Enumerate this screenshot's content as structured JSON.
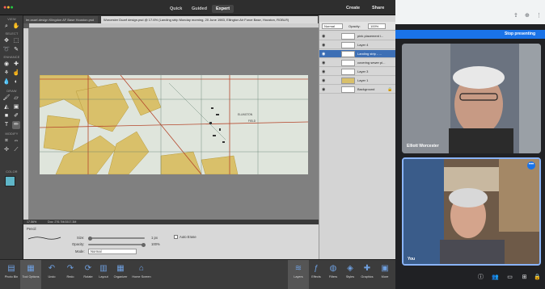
{
  "editor": {
    "modes": [
      "Quick",
      "Guided",
      "Expert"
    ],
    "active_mode": "Expert",
    "create_label": "Create",
    "share_label": "Share",
    "doc_tabs": [
      "ler-ssarf-design Klingdon AF Base Houston.psd",
      "Worcester Duarf design.psd @ 17.6% (Landing strip Monday morning, 20 June 1983, Ellington Air Force Base, Houston, ROBLR)"
    ],
    "tool_sections": [
      "VIEW",
      "SELECT",
      "ENHANCE",
      "DRAW",
      "MODIFY",
      "COLOR"
    ],
    "status_zoom": "17.56%",
    "status_doc": "Doc: 276.7M/1517.3M",
    "tool_options": {
      "tool_name": "Pencil",
      "size_label": "Size:",
      "size_value": "1 px",
      "opacity_label": "Opacity:",
      "opacity_value": "100%",
      "mode_label": "Mode:",
      "mode_value": "Normal",
      "auto_erase_label": "Auto Erase"
    },
    "layers": {
      "blend_mode": "Normal",
      "opacity_label": "Opacity:",
      "opacity_value": "100%",
      "rows": [
        {
          "name": "pink placement i...",
          "selected": false
        },
        {
          "name": "Layer 4",
          "selected": false
        },
        {
          "name": "Landing strip - ...",
          "selected": true
        },
        {
          "name": "covering sewer pi...",
          "selected": false
        },
        {
          "name": "Layer 3",
          "selected": false
        },
        {
          "name": "Layer 1",
          "selected": false
        },
        {
          "name": "Background",
          "selected": false
        }
      ]
    },
    "taskbar": {
      "left": [
        "Photo Bin",
        "Tool Options",
        "Undo",
        "Redo",
        "Rotate",
        "Layout",
        "Organizer",
        "Home Screen"
      ],
      "right": [
        "Layers",
        "Effects",
        "Filters",
        "Styles",
        "Graphics",
        "More"
      ]
    },
    "map_labels": [
      "ELLINGTON",
      "FIELD"
    ]
  },
  "call": {
    "stop_presenting": "Stop presenting",
    "participants": [
      {
        "name": "Elliott Worcester"
      },
      {
        "name": "You"
      }
    ],
    "accent": "#1a73e8"
  }
}
